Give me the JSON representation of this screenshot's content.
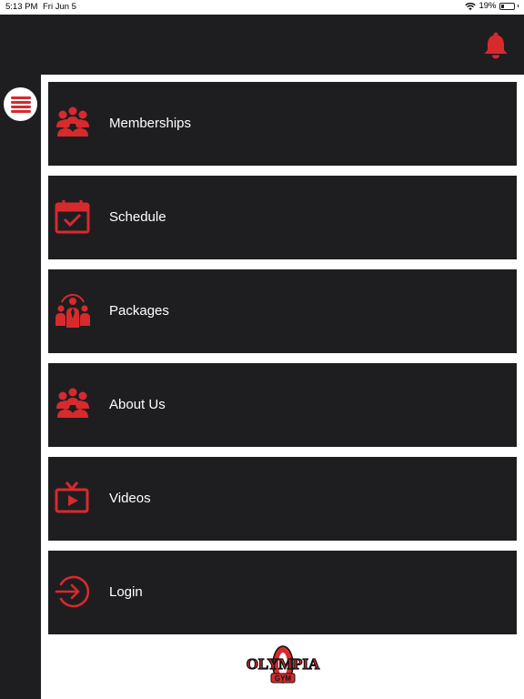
{
  "status_bar": {
    "time": "5:13 PM",
    "date": "Fri Jun 5",
    "battery": "19%"
  },
  "menu": {
    "items": [
      {
        "label": "Memberships",
        "icon": "group-icon"
      },
      {
        "label": "Schedule",
        "icon": "calendar-check-icon"
      },
      {
        "label": "Packages",
        "icon": "team-leader-icon"
      },
      {
        "label": "About Us",
        "icon": "group-icon"
      },
      {
        "label": "Videos",
        "icon": "tv-play-icon"
      },
      {
        "label": "Login",
        "icon": "login-arrow-icon"
      }
    ]
  },
  "logo": {
    "line1": "OLYMPIA",
    "line2": "GYM"
  },
  "colors": {
    "accent": "#d72a2d",
    "dark": "#1e1e21",
    "light": "#ffffff"
  }
}
